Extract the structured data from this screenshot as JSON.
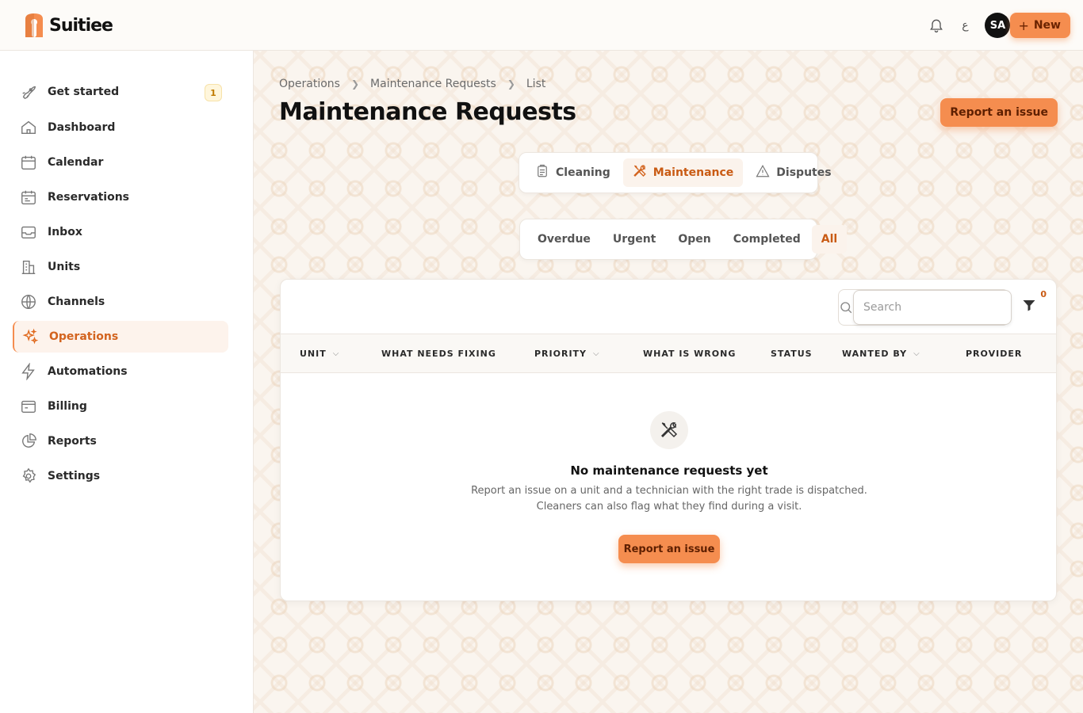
{
  "app": {
    "name": "Suitiee"
  },
  "topbar": {
    "lang_label": "ع",
    "avatar_initials": "SA",
    "new_label": "New"
  },
  "sidebar": {
    "items": [
      {
        "label": "Get started",
        "icon": "rocket-icon",
        "badge": "1"
      },
      {
        "label": "Dashboard",
        "icon": "home-icon"
      },
      {
        "label": "Calendar",
        "icon": "calendar-icon"
      },
      {
        "label": "Reservations",
        "icon": "reservations-calendar-icon"
      },
      {
        "label": "Inbox",
        "icon": "inbox-icon"
      },
      {
        "label": "Units",
        "icon": "building-icon"
      },
      {
        "label": "Channels",
        "icon": "globe-icon"
      },
      {
        "label": "Operations",
        "icon": "sparkles-icon",
        "active": true
      },
      {
        "label": "Automations",
        "icon": "lightning-icon"
      },
      {
        "label": "Billing",
        "icon": "wallet-icon"
      },
      {
        "label": "Reports",
        "icon": "pie-chart-icon"
      },
      {
        "label": "Settings",
        "icon": "gear-icon"
      }
    ]
  },
  "breadcrumb": [
    "Operations",
    "Maintenance Requests",
    "List"
  ],
  "page": {
    "title": "Maintenance Requests",
    "report_label": "Report an issue"
  },
  "tabs": [
    {
      "label": "Cleaning",
      "icon": "clipboard-icon"
    },
    {
      "label": "Maintenance",
      "icon": "tools-icon",
      "active": true
    },
    {
      "label": "Disputes",
      "icon": "warning-icon"
    }
  ],
  "filters": [
    {
      "label": "Overdue"
    },
    {
      "label": "Urgent"
    },
    {
      "label": "Open"
    },
    {
      "label": "Completed"
    },
    {
      "label": "All",
      "active": true
    }
  ],
  "table": {
    "search_placeholder": "Search",
    "filter_count": "0",
    "columns": [
      {
        "label": "UNIT",
        "sortable": true
      },
      {
        "label": "WHAT NEEDS FIXING",
        "sortable": false
      },
      {
        "label": "PRIORITY",
        "sortable": true
      },
      {
        "label": "WHAT IS WRONG",
        "sortable": false
      },
      {
        "label": "STATUS",
        "sortable": false
      },
      {
        "label": "WANTED BY",
        "sortable": true
      },
      {
        "label": "PROVIDER",
        "sortable": false
      }
    ]
  },
  "empty_state": {
    "title": "No maintenance requests yet",
    "line1": "Report an issue on a unit and a technician with the right trade is dispatched.",
    "line2": "Cleaners can also flag what they find during a visit.",
    "button_label": "Report an issue"
  },
  "colors": {
    "accent": "#f58d4f",
    "accent_text": "#c95b14"
  }
}
